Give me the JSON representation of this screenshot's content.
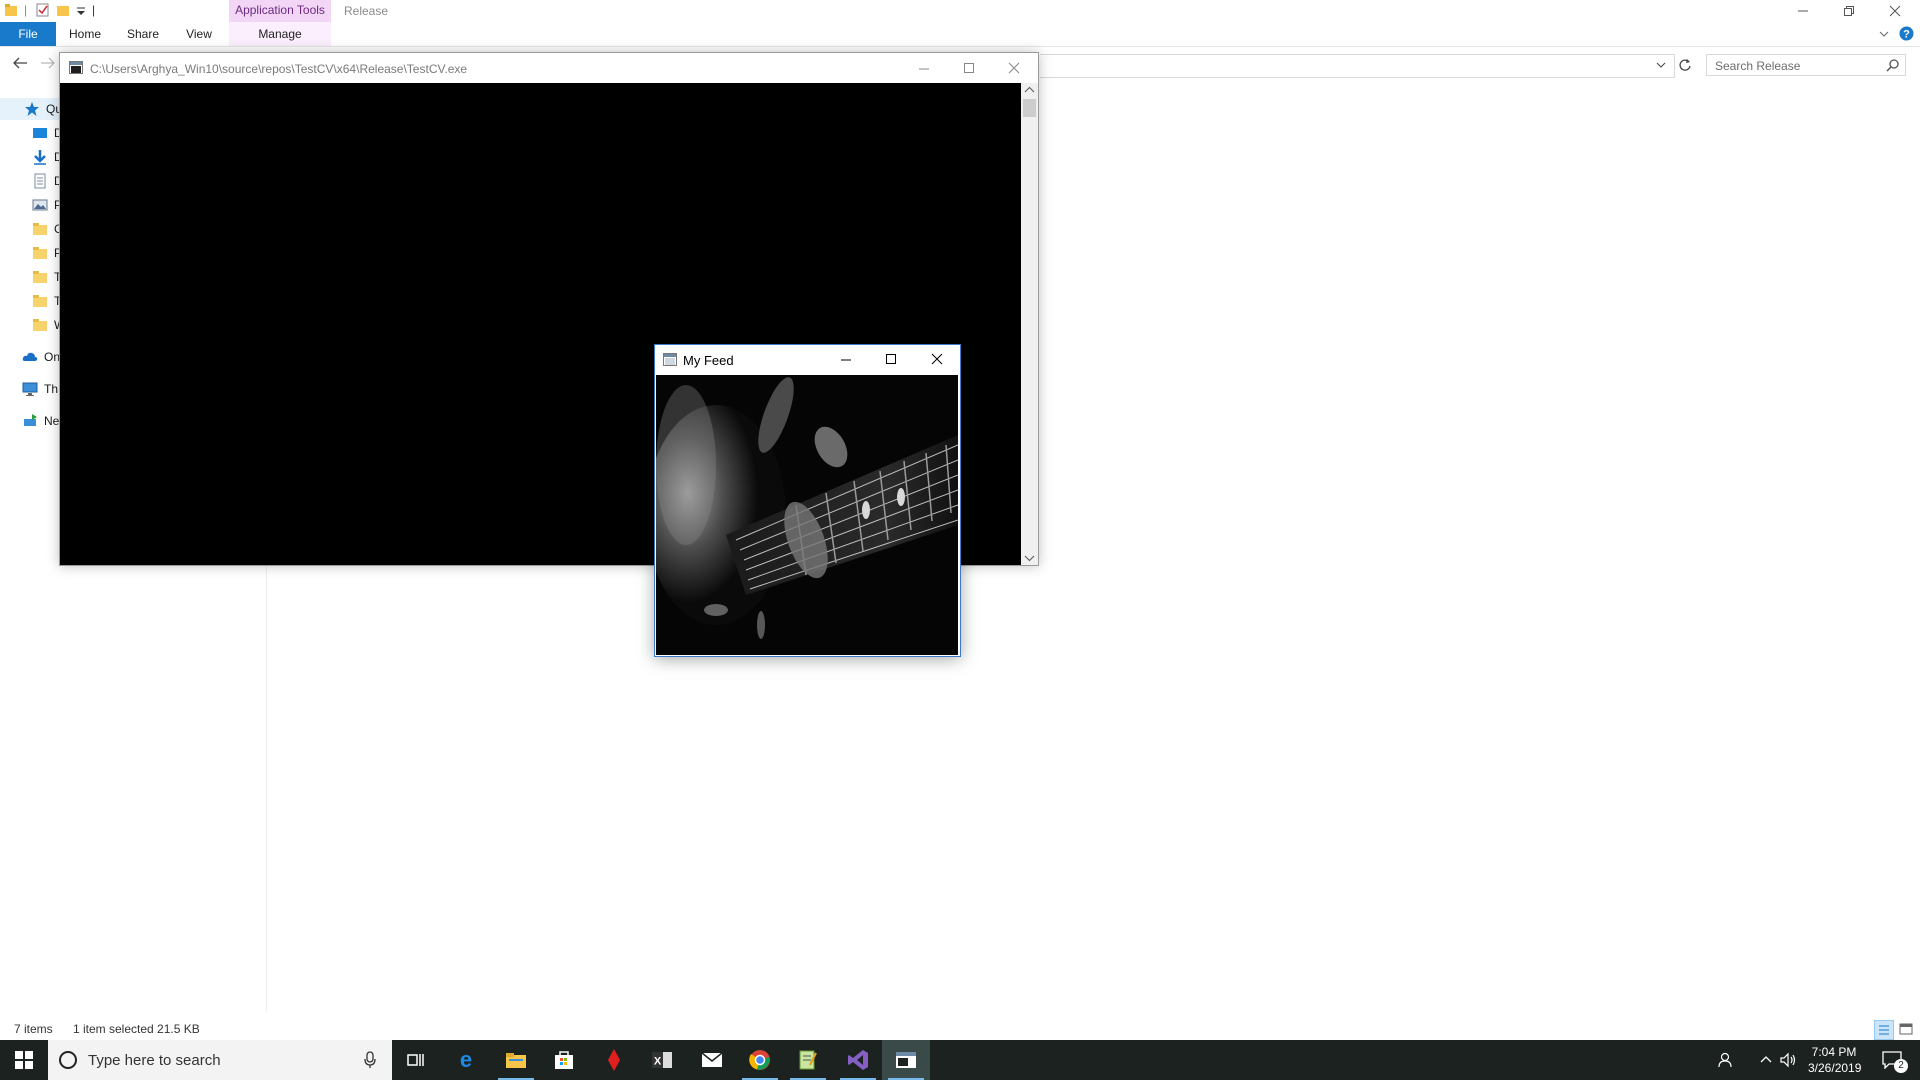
{
  "explorer": {
    "contextual_tab_label": "Application Tools",
    "window_title": "Release",
    "ribbon_tabs": [
      "File",
      "Home",
      "Share",
      "View",
      "Manage"
    ],
    "search_placeholder": "Search Release",
    "nav": {
      "items": [
        {
          "label": "Qu",
          "icon": "star-icon"
        },
        {
          "label": "D",
          "icon": "desktop-icon"
        },
        {
          "label": "D",
          "icon": "download-icon"
        },
        {
          "label": "D",
          "icon": "document-icon"
        },
        {
          "label": "P",
          "icon": "pictures-icon"
        },
        {
          "label": "G",
          "icon": "folder-icon"
        },
        {
          "label": "P",
          "icon": "folder-icon"
        },
        {
          "label": "T",
          "icon": "folder-icon"
        },
        {
          "label": "T",
          "icon": "folder-icon"
        },
        {
          "label": "W",
          "icon": "folder-icon"
        },
        {
          "label": "On",
          "icon": "onedrive-icon"
        },
        {
          "label": "Th",
          "icon": "this-pc-icon"
        },
        {
          "label": "Ne",
          "icon": "network-icon"
        }
      ]
    },
    "status": {
      "items_count": "7 items",
      "selection": "1 item selected  21.5 KB"
    },
    "colors": {
      "file_tab": "#1979ca",
      "context_tab": "#f3d6f6"
    }
  },
  "console": {
    "title": "C:\\Users\\Arghya_Win10\\source\\repos\\TestCV\\x64\\Release\\TestCV.exe"
  },
  "feed_window": {
    "title": "My Feed",
    "image_alt": "grayscale photo of hand playing guitar"
  },
  "taskbar": {
    "search_placeholder": "Type here to search",
    "apps": [
      "task-view-icon",
      "edge-icon",
      "file-explorer-icon",
      "store-icon",
      "red-app-icon",
      "excel-icon",
      "mail-icon",
      "chrome-icon",
      "notepad-icon",
      "visual-studio-icon",
      "console-app-icon"
    ],
    "time": "7:04 PM",
    "date": "3/26/2019",
    "notification_count": "2"
  }
}
